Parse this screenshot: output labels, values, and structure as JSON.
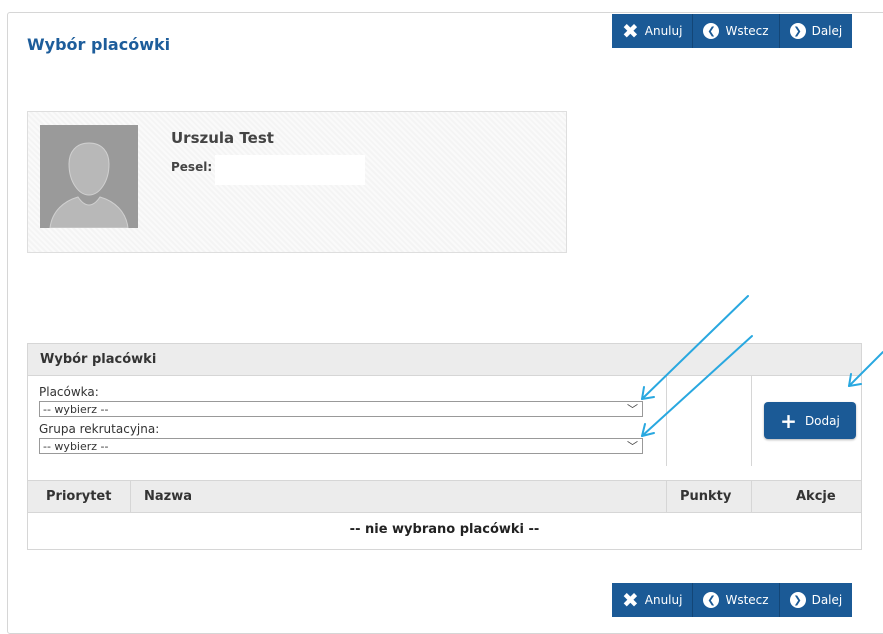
{
  "page": {
    "title": "Wybór placówki"
  },
  "toolbar": {
    "cancel_label": "Anuluj",
    "back_label": "Wstecz",
    "next_label": "Dalej"
  },
  "profile": {
    "name": "Urszula Test",
    "pesel_label": "Pesel:"
  },
  "selection": {
    "header": "Wybór placówki",
    "facility_label": "Placówka:",
    "facility_value": "-- wybierz --",
    "group_label": "Grupa rekrutacyjna:",
    "group_value": "-- wybierz --",
    "add_label": "Dodaj"
  },
  "table": {
    "columns": [
      "Priorytet",
      "Nazwa",
      "Punkty",
      "Akcje"
    ],
    "empty_message": "-- nie wybrano placówki --"
  },
  "colors": {
    "accent": "#1b5a96",
    "title": "#1d5d9b",
    "annotation_arrow": "#29a8e0"
  },
  "icons": {
    "cancel": "close-x-icon",
    "back": "circle-arrow-left-icon",
    "next": "circle-arrow-right-icon",
    "add": "plus-icon",
    "avatar": "user-silhouette-icon",
    "select": "chevron-down-icon"
  }
}
